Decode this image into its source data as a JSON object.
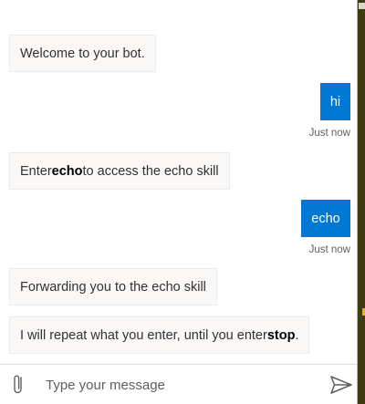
{
  "messages": [
    {
      "from": "bot",
      "text": "Welcome to your bot."
    },
    {
      "from": "user",
      "text": "hi",
      "timestamp": "Just now"
    },
    {
      "from": "bot",
      "parts": [
        "Enter ",
        "echo",
        " to access the echo skill"
      ]
    },
    {
      "from": "user",
      "text": "echo",
      "timestamp": "Just now"
    },
    {
      "from": "bot",
      "text": "Forwarding you to the echo skill"
    },
    {
      "from": "bot",
      "parts": [
        "I will repeat what you enter, until you enter ",
        "stop",
        "."
      ]
    }
  ],
  "composer": {
    "placeholder": "Type your message",
    "value": "",
    "attach_icon": "paperclip-icon",
    "send_icon": "send-icon"
  },
  "colors": {
    "user_bubble": "#0078d4",
    "bot_bubble": "#f9f8f7",
    "bot_border": "#edebe9",
    "scrollbar_track": "#3f3a12",
    "scrollbar_marker": "#e8b600"
  }
}
